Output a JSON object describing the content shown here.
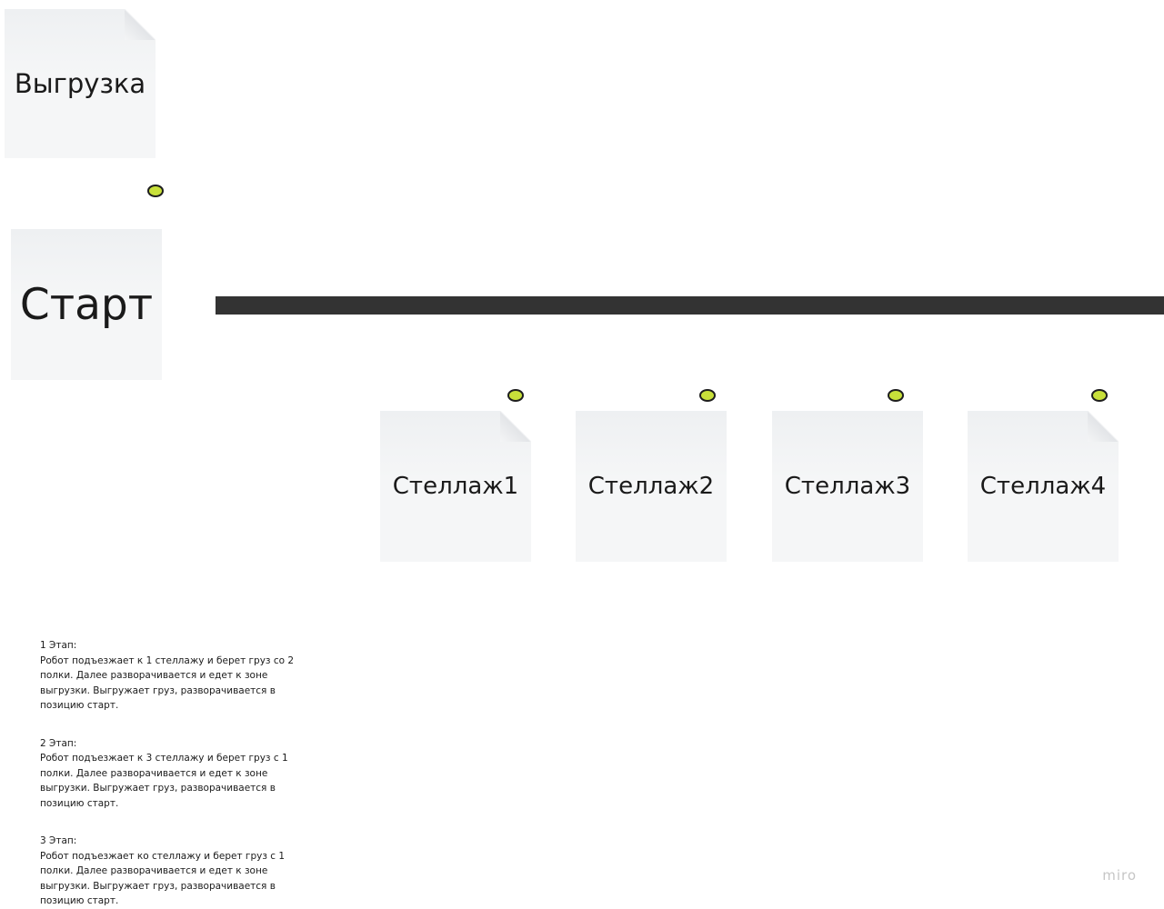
{
  "colors": {
    "dot": "#c8e03a",
    "track": "#333333",
    "sticky": "#f5f6f7"
  },
  "notes": {
    "unload": "Выгрузка",
    "start": "Старт",
    "racks": [
      "Стеллаж1",
      "Стеллаж2",
      "Стеллаж3",
      "Стеллаж4"
    ]
  },
  "stages": [
    {
      "title": "1 Этап:",
      "text": "Робот подъезжает к 1 стеллажу и берет груз со 2 полки. Далее разворачивается и едет к зоне выгрузки. Выгружает груз, разворачивается в позицию старт."
    },
    {
      "title": "2 Этап:",
      "text": "Робот подъезжает к 3 стеллажу и берет груз с 1 полки. Далее разворачивается и едет к зоне выгрузки. Выгружает груз, разворачивается в позицию старт."
    },
    {
      "title": "3 Этап:",
      "text": "Робот подъезжает ко стеллажу и берет груз с 1 полки. Далее разворачивается и едет к зоне выгрузки. Выгружает груз, разворачивается в позицию старт."
    }
  ],
  "watermark": "miro"
}
